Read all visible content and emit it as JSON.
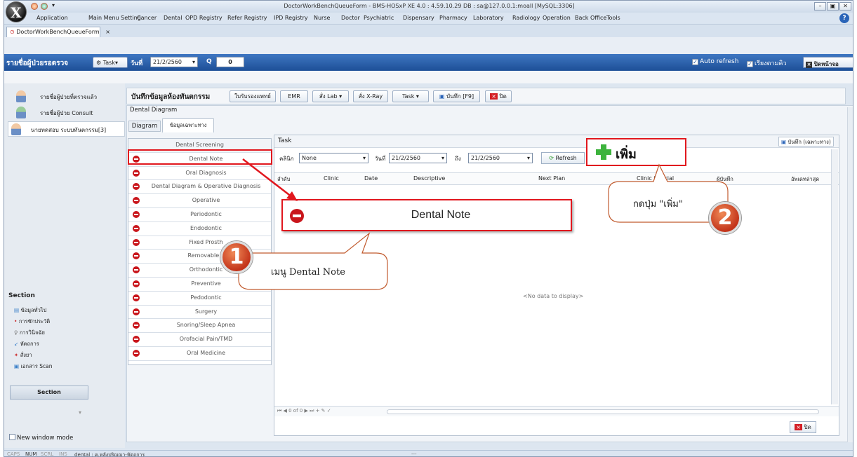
{
  "window": {
    "title": "DoctorWorkBenchQueueForm - BMS-HOSxP XE 4.0 : 4.59.10.29 DB : sa@127.0.0.1:moall [MySQL:3306]"
  },
  "menu": [
    "Application",
    "Main Menu Setting",
    "Cancer",
    "Dental",
    "OPD Registry",
    "Refer Registry",
    "IPD Registry",
    "Nurse",
    "Doctor",
    "Psychiatric",
    "Dispensary",
    "Pharmacy",
    "Laboratory",
    "Radiology",
    "Operation",
    "Back Office",
    "Tools"
  ],
  "doc_tab": {
    "label": "DoctorWorkBenchQueueForm",
    "close": "×"
  },
  "toolbar": {
    "queue_label": "รายชื่อผู้ป่วยรอตรวจ",
    "task_label": "Task▾",
    "date_label": "วันที่",
    "date_value": "21/2/2560",
    "q_label": "Q",
    "q_value": "0",
    "auto_refresh": "Auto refresh",
    "sort_queue": "เรียงตามคิว",
    "close_screen": "ปิดหน้าจอ"
  },
  "left_list": [
    {
      "label": "รายชื่อผู้ป่วยที่ตรวจแล้ว"
    },
    {
      "label": "รายชื่อผู้ป่วย Consult"
    },
    {
      "label": "นายทดสอบ ระบบทันตกรรม[3]"
    }
  ],
  "section": {
    "title": "Section",
    "items": [
      "ข้อมูลทั่วไป",
      "การซักประวัติ",
      "การวินิจฉัย",
      "หัตถการ",
      "สั่งยา",
      "เอกสาร Scan"
    ],
    "button": "Section",
    "new_window": "New window mode"
  },
  "header": {
    "title": "บันทึกข้อมูลห้องทันตกรรม",
    "buttons": [
      "ใบรับรองแพทย์",
      "EMR",
      "สั่ง Lab ▾",
      "สั่ง X-Ray",
      "Task ▾",
      "บันทึก [F9]",
      "ปิด"
    ]
  },
  "diagram": {
    "label": "Dental Diagram",
    "tabs": [
      "Diagram",
      "ข้อมูลเฉพาะทาง"
    ]
  },
  "dental_list": {
    "header": "Dental Screening",
    "items": [
      "Dental Note",
      "Oral Diagnosis",
      "Dental Diagram & Operative Diagnosis",
      "Operative",
      "Periodontic",
      "Endodontic",
      "Fixed Prosth",
      "Removable P",
      "Orthodontic",
      "Preventive",
      "Pedodontic",
      "Surgery",
      "Snoring/Sleep Apnea",
      "Orofacial Pain/TMD",
      "Oral Medicine"
    ]
  },
  "task": {
    "title": "Task",
    "save_special": "บันทึก (เฉพาะทาง)",
    "clinic_label": "คลินิก",
    "clinic_value": "None",
    "date_from_label": "วันที่",
    "date_from": "21/2/2560",
    "date_to_label": "ถึง",
    "date_to": "21/2/2560",
    "refresh": "Refresh",
    "columns": [
      "ลำดับ",
      "Clinic",
      "Date",
      "Descriptive",
      "Next Plan",
      "Clinic Special",
      "ผู้บันทึก",
      "อัพเดทล่าสุด"
    ],
    "empty": "<No data to display>",
    "nav": "⏮ ◀ 0 of 0 ▶ ⏭ + ✎ ✓",
    "close": "ปิด"
  },
  "annotations": {
    "add_button": "เพิ่ม",
    "enlarged_item": "Dental Note",
    "callout1": "เมนู Dental Note",
    "callout2": "กดปุ่ม \"เพิ่ม\"",
    "badge1": "1",
    "badge2": "2"
  },
  "statusbar": {
    "caps": "CAPS",
    "num": "NUM",
    "scrl": "SCRL",
    "ins": "INS",
    "info": "dental : ค.หลังปริญญา-หัตถการ",
    "extra": "---"
  },
  "colors": {
    "accent_blue": "#1d4f97",
    "highlight_red": "#e1171e",
    "callout_border": "#c15b2f",
    "add_green": "#3db33d"
  }
}
